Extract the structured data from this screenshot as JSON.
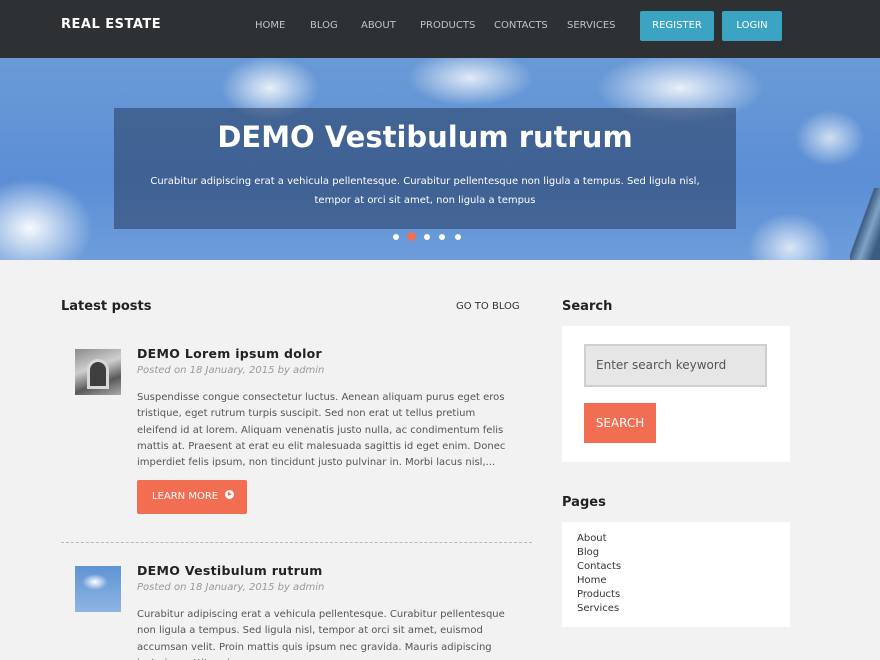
{
  "header": {
    "brand": "REAL ESTATE",
    "nav": [
      "HOME",
      "BLOG",
      "ABOUT",
      "PRODUCTS",
      "CONTACTS",
      "SERVICES"
    ],
    "register_label": "REGISTER",
    "login_label": "LOGIN"
  },
  "hero": {
    "title": "DEMO Vestibulum rutrum",
    "text": "Curabitur adipiscing erat a vehicula pellentesque. Curabitur pellentesque non ligula a tempus. Sed ligula nisl, tempor at orci sit amet, non ligula a tempus",
    "slides_total": 5,
    "active_slide": 2
  },
  "latest": {
    "title": "Latest posts",
    "go_to_blog": "GO TO BLOG",
    "posts": [
      {
        "title": "DEMO Lorem ipsum dolor",
        "meta": "Posted on 18 January, 2015 by admin",
        "body": "Suspendisse congue consectetur luctus. Aenean aliquam purus eget eros tristique, eget rutrum turpis suscipit. Sed non erat ut tellus pretium eleifend id at lorem. Aliquam venenatis justo nulla, ac condimentum felis mattis at. Praesent at erat eu elit malesuada sagittis id eget enim. Donec imperdiet felis ipsum, non tincidunt justo pulvinar in. Morbi lacus nisl,...",
        "button": "LEARN MORE"
      },
      {
        "title": "DEMO Vestibulum rutrum",
        "meta": "Posted on 18 January, 2015 by admin",
        "body": "Curabitur adipiscing erat a vehicula pellentesque. Curabitur pellentesque non ligula a tempus. Sed ligula nisl, tempor at orci sit amet, euismod accumsan velit. Proin mattis quis ipsum nec gravida. Mauris adipiscing justo in porttitor viverra."
      }
    ]
  },
  "sidebar": {
    "search_title": "Search",
    "search_placeholder": "Enter search keyword",
    "search_button": "SEARCH",
    "pages_title": "Pages",
    "pages": [
      "About",
      "Blog",
      "Contacts",
      "Home",
      "Products",
      "Services"
    ]
  },
  "colors": {
    "topbar": "#2e3134",
    "accent_blue": "#3ba4c3",
    "accent_orange": "#f26e53"
  }
}
